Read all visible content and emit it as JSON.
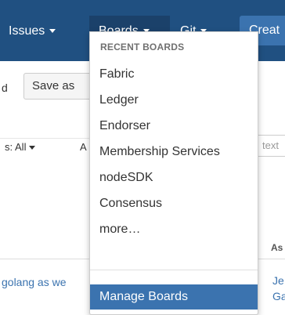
{
  "nav": {
    "issues": "Issues",
    "boards": "Boards",
    "git": "Git",
    "create": "Creat"
  },
  "background": {
    "toolbar_fragment": "d",
    "save_as_button": "Save as",
    "status_filter": "s: All",
    "filter_fragment": "A",
    "text_input_placeholder": "text",
    "column_header": "As",
    "row_text": "golang as we",
    "row_assignee_1": "Je",
    "row_assignee_2": "Ga"
  },
  "boards_menu": {
    "heading": "RECENT BOARDS",
    "items": [
      "Fabric",
      "Ledger",
      "Endorser",
      "Membership Services",
      "nodeSDK",
      "Consensus",
      "more…"
    ],
    "manage": "Manage Boards"
  },
  "colors": {
    "nav_bg": "#205081",
    "nav_active_bg": "#1b416a",
    "accent": "#3b73af",
    "text": "#333333"
  }
}
